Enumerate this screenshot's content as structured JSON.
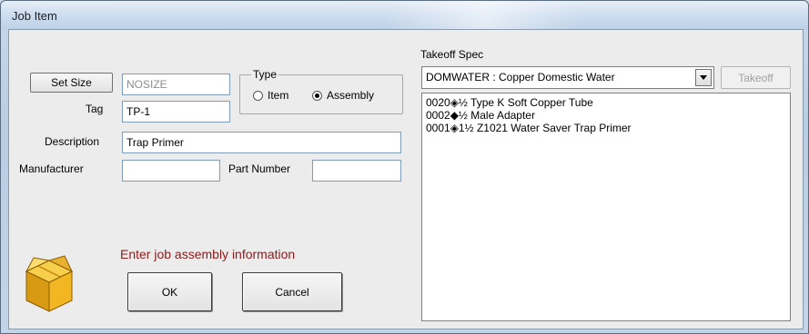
{
  "window": {
    "title": "Job Item"
  },
  "form": {
    "set_size_label": "Set Size",
    "size_value": "NOSIZE",
    "tag_label": "Tag",
    "tag_value": "TP-1",
    "description_label": "Description",
    "description_value": "Trap Primer",
    "manufacturer_label": "Manufacturer",
    "manufacturer_value": "",
    "part_number_label": "Part Number",
    "part_number_value": ""
  },
  "type_group": {
    "title": "Type",
    "options": [
      {
        "label": "Item",
        "selected": false
      },
      {
        "label": "Assembly",
        "selected": true
      }
    ]
  },
  "takeoff": {
    "label": "Takeoff Spec",
    "selected": "DOMWATER : Copper Domestic Water",
    "button_label": "Takeoff",
    "items": [
      "0020◈½ Type K Soft Copper Tube",
      "0002◆½ Male Adapter",
      "0001◈1½ Z1021 Water Saver Trap Primer"
    ]
  },
  "message": "Enter job assembly information",
  "buttons": {
    "ok": "OK",
    "cancel": "Cancel"
  },
  "icons": {
    "assembly": "assembly-box-icon"
  }
}
